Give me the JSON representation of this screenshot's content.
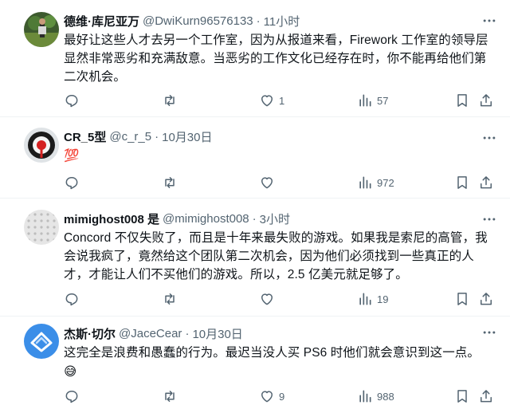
{
  "colors": {
    "text": "#0f1419",
    "secondary": "#536471",
    "divider": "#eff3f4"
  },
  "tweets": [
    {
      "name": "德维·库尼亚万",
      "handle": "@DwiKurn96576133",
      "time": "11小时",
      "text": "最好让这些人才去另一个工作室，因为从报道来看，Firework 工作室的领导层显然非常恶劣和充满敌意。当恶劣的工作文化已经存在时，你不能再给他们第二次机会。",
      "replies": "",
      "retweets": "",
      "likes": "1",
      "views": "57"
    },
    {
      "name": "CR_5型",
      "handle": "@c_r_5",
      "time": "10月30日",
      "text": "💯",
      "replies": "",
      "retweets": "",
      "likes": "",
      "views": "972"
    },
    {
      "name": "mimighost008 是",
      "handle": "@mimighost008",
      "time": "3小时",
      "text": "Concord 不仅失败了，而且是十年来最失败的游戏。如果我是索尼的高管，我会说我疯了，竟然给这个团队第二次机会，因为他们必须找到一些真正的人才，才能让人们不买他们的游戏。所以，2.5 亿美元就足够了。",
      "replies": "",
      "retweets": "",
      "likes": "",
      "views": "19"
    },
    {
      "name": "杰斯·切尔",
      "handle": "@JaceCear",
      "time": "10月30日",
      "text": "这完全是浪费和愚蠢的行为。最迟当没人买 PS6 时他们就会意识到这一点。",
      "emoji": "😅",
      "replies": "",
      "retweets": "",
      "likes": "9",
      "views": "988"
    }
  ]
}
